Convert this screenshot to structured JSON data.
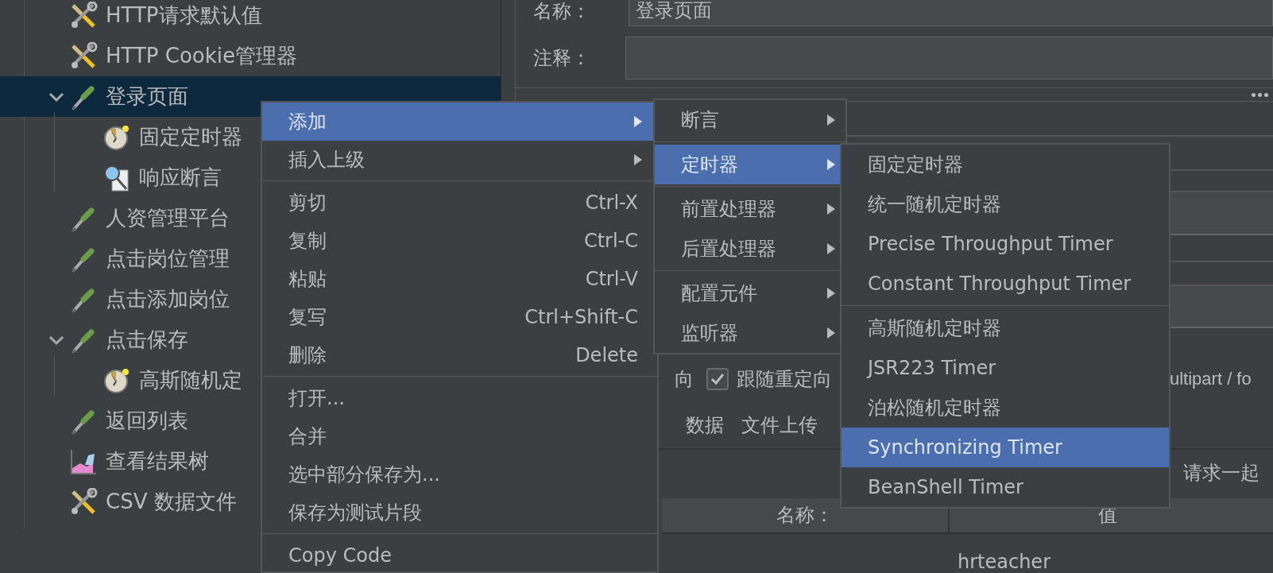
{
  "tree": [
    {
      "label": "HTTP请求默认值",
      "kind": "config",
      "selected": false
    },
    {
      "label": "HTTP Cookie管理器",
      "kind": "config",
      "selected": false
    },
    {
      "label": "登录页面",
      "kind": "sampler",
      "selected": true,
      "expanded": true,
      "children": [
        {
          "label": "固定定时器",
          "kind": "timer",
          "selected": false
        },
        {
          "label": "响应断言",
          "kind": "assertion",
          "selected": false
        }
      ]
    },
    {
      "label": "人资管理平台",
      "kind": "sampler",
      "selected": false
    },
    {
      "label": "点击岗位管理",
      "kind": "sampler",
      "selected": false
    },
    {
      "label": "点击添加岗位",
      "kind": "sampler",
      "selected": false
    },
    {
      "label": "点击保存",
      "kind": "sampler",
      "selected": false,
      "expanded": true,
      "children": [
        {
          "label": "高斯随机定",
          "kind": "timer",
          "selected": false
        }
      ]
    },
    {
      "label": "返回列表",
      "kind": "sampler",
      "selected": false
    },
    {
      "label": "查看结果树",
      "kind": "listener",
      "selected": false
    },
    {
      "label": "CSV 数据文件",
      "kind": "config",
      "selected": false
    }
  ],
  "editor": {
    "name_label": "名称：",
    "name_value": "登录页面",
    "comment_label": "注释：",
    "redirect_tail": "向",
    "follow_redirect": {
      "label": "跟随重定向",
      "checked": true
    },
    "multipart_text": "ultipart / fo",
    "tabs": [
      "数据",
      "文件上传"
    ],
    "browser_text": "请求一起",
    "table": {
      "columns": [
        "名称：",
        "值"
      ],
      "rows": [
        {
          "column_2": "hrteacher"
        }
      ]
    }
  },
  "context_menu": [
    {
      "kind": "submenu",
      "label": "添加",
      "selected": true
    },
    {
      "kind": "submenu",
      "label": "插入上级",
      "selected": false
    },
    {
      "kind": "separator"
    },
    {
      "kind": "item",
      "label": "剪切",
      "shortcut": "Ctrl-X",
      "selected": false
    },
    {
      "kind": "item",
      "label": "复制",
      "shortcut": "Ctrl-C",
      "selected": false
    },
    {
      "kind": "item",
      "label": "粘贴",
      "shortcut": "Ctrl-V",
      "selected": false
    },
    {
      "kind": "item",
      "label": "复写",
      "shortcut": "Ctrl+Shift-C",
      "selected": false
    },
    {
      "kind": "item",
      "label": "删除",
      "shortcut": "Delete",
      "selected": false
    },
    {
      "kind": "separator"
    },
    {
      "kind": "item",
      "label": "打开...",
      "selected": false
    },
    {
      "kind": "item",
      "label": "合并",
      "selected": false
    },
    {
      "kind": "item",
      "label": "选中部分保存为...",
      "selected": false
    },
    {
      "kind": "item",
      "label": "保存为测试片段",
      "selected": false
    },
    {
      "kind": "separator"
    },
    {
      "kind": "item",
      "label": "Copy Code",
      "selected": false
    }
  ],
  "add_menu": [
    {
      "kind": "submenu",
      "label": "断言",
      "selected": false
    },
    {
      "kind": "separator"
    },
    {
      "kind": "submenu",
      "label": "定时器",
      "selected": true
    },
    {
      "kind": "separator"
    },
    {
      "kind": "submenu",
      "label": "前置处理器",
      "selected": false
    },
    {
      "kind": "submenu",
      "label": "后置处理器",
      "selected": false
    },
    {
      "kind": "separator"
    },
    {
      "kind": "submenu",
      "label": "配置元件",
      "selected": false
    },
    {
      "kind": "submenu",
      "label": "监听器",
      "selected": false
    }
  ],
  "timer_menu": [
    {
      "kind": "item",
      "label": "固定定时器",
      "selected": false
    },
    {
      "kind": "item",
      "label": "统一随机定时器",
      "selected": false
    },
    {
      "kind": "item",
      "label": "Precise Throughput Timer",
      "selected": false
    },
    {
      "kind": "item",
      "label": "Constant Throughput Timer",
      "selected": false
    },
    {
      "kind": "separator"
    },
    {
      "kind": "item",
      "label": "高斯随机定时器",
      "selected": false
    },
    {
      "kind": "item",
      "label": "JSR223 Timer",
      "selected": false
    },
    {
      "kind": "item",
      "label": "泊松随机定时器",
      "selected": false
    },
    {
      "kind": "item",
      "label": "Synchronizing Timer",
      "selected": true
    },
    {
      "kind": "item",
      "label": "BeanShell Timer",
      "selected": false
    }
  ]
}
